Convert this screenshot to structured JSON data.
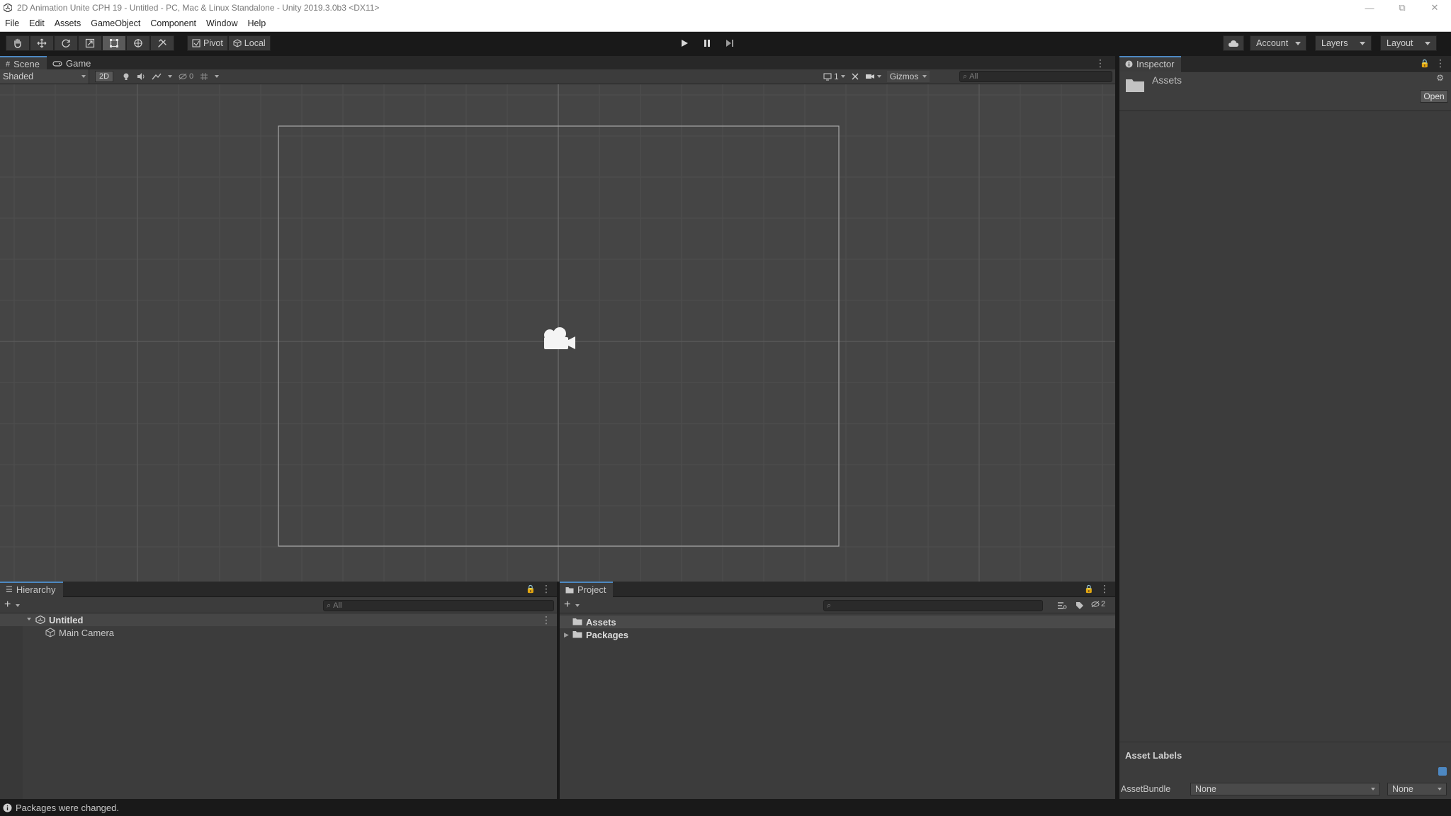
{
  "window": {
    "title": "2D Animation Unite CPH 19 - Untitled - PC, Mac & Linux Standalone - Unity 2019.3.0b3 <DX11>"
  },
  "menu": [
    "File",
    "Edit",
    "Assets",
    "GameObject",
    "Component",
    "Window",
    "Help"
  ],
  "toolbar": {
    "tools": [
      "hand-tool",
      "move-tool",
      "rotate-tool",
      "scale-tool",
      "rect-tool",
      "transform-tool",
      "custom-tool"
    ],
    "active_tool": "rect-tool",
    "pivot_label": "Pivot",
    "local_label": "Local",
    "account_label": "Account",
    "layers_label": "Layers",
    "layout_label": "Layout"
  },
  "scene_panel": {
    "tabs": [
      "Scene",
      "Game"
    ],
    "active_tab": "Scene",
    "shading_mode": "Shaded",
    "mode_2d_label": "2D",
    "hidden_count": "0",
    "camera_count": "1",
    "gizmos_label": "Gizmos",
    "search_placeholder": "All"
  },
  "inspector": {
    "tab_label": "Inspector",
    "selection_name": "Assets",
    "open_button_label": "Open",
    "asset_labels_heading": "Asset Labels",
    "assetbundle_label": "AssetBundle",
    "assetbundle_value": "None",
    "assetbundle_variant": "None"
  },
  "hierarchy": {
    "tab_label": "Hierarchy",
    "search_placeholder": "All",
    "scene_name": "Untitled",
    "items": [
      "Main Camera"
    ]
  },
  "project": {
    "tab_label": "Project",
    "hidden_packages_count": "2",
    "folders": [
      "Assets",
      "Packages"
    ]
  },
  "status": {
    "message": "Packages were changed."
  },
  "colors": {
    "accent": "#4d88c2",
    "panel_bg": "#3c3c3c",
    "scene_bg": "#454545",
    "toolbar_bg": "#191919"
  }
}
